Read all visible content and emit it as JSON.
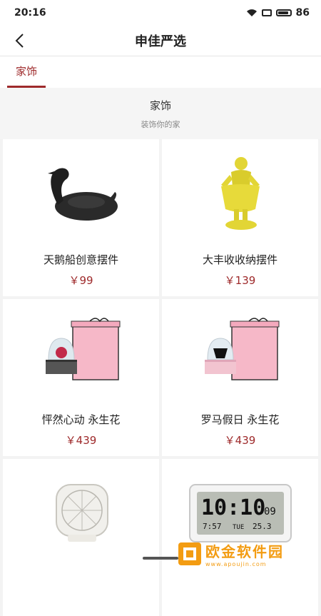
{
  "status_bar": {
    "time": "20:16",
    "battery": "86"
  },
  "nav": {
    "title": "申佳严选"
  },
  "tabs": [
    {
      "label": "家饰"
    }
  ],
  "section": {
    "title": "家饰",
    "subtitle": "装饰你的家"
  },
  "products": [
    {
      "name": "天鹅船创意摆件",
      "price": "￥99",
      "image": "black-swan-figurine"
    },
    {
      "name": "大丰收收纳摆件",
      "price": "￥139",
      "image": "yellow-figure-statue"
    },
    {
      "name": "怦然心动 永生花",
      "price": "￥439",
      "image": "preserved-flower-pink-box"
    },
    {
      "name": "罗马假日 永生花",
      "price": "￥439",
      "image": "preserved-flower-pink-box-2"
    },
    {
      "name": "",
      "price": "",
      "image": "white-desk-fan"
    },
    {
      "name": "",
      "price": "",
      "image": "digital-alarm-clock"
    }
  ],
  "clock_display": {
    "time": "10:10",
    "seconds": "09",
    "sub_left": "7:57",
    "day": "TUE",
    "date": "25.3"
  },
  "watermark": {
    "name": "欧金软件园",
    "url": "www.apoujin.com"
  },
  "colors": {
    "accent": "#9e2a2b",
    "background": "#f3f3f3",
    "watermark": "#f39c12"
  }
}
